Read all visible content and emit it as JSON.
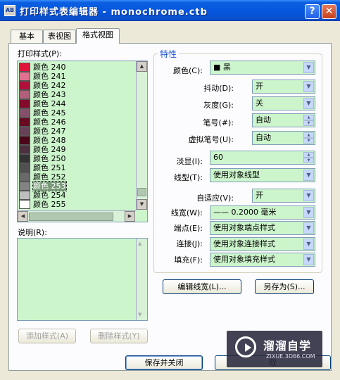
{
  "window": {
    "title": "打印样式表编辑器 - monochrome.ctb",
    "help": "?",
    "close": "✕",
    "icon": "AB"
  },
  "tabs": [
    "基本",
    "表视图",
    "格式视图"
  ],
  "left": {
    "styles_label": "打印样式(P):",
    "styles": [
      {
        "label": "颜色 240",
        "color": "#e0143c"
      },
      {
        "label": "颜色 241",
        "color": "#e07090"
      },
      {
        "label": "颜色 242",
        "color": "#b0103a"
      },
      {
        "label": "颜色 243",
        "color": "#b0607a"
      },
      {
        "label": "颜色 244",
        "color": "#840a2c"
      },
      {
        "label": "颜色 245",
        "color": "#84506a"
      },
      {
        "label": "颜色 246",
        "color": "#680822"
      },
      {
        "label": "颜色 247",
        "color": "#684058"
      },
      {
        "label": "颜色 248",
        "color": "#4c061a"
      },
      {
        "label": "颜色 249",
        "color": "#4c3040"
      },
      {
        "label": "颜色 250",
        "color": "#333333"
      },
      {
        "label": "颜色 251",
        "color": "#505050"
      },
      {
        "label": "颜色 252",
        "color": "#696969"
      },
      {
        "label": "颜色 253",
        "color": "#828282"
      },
      {
        "label": "颜色 254",
        "color": "#bebebe"
      },
      {
        "label": "颜色 255",
        "color": "#ffffff"
      }
    ],
    "selected_index": 13,
    "desc_label": "说明(R):",
    "add_btn": "添加样式(A)",
    "del_btn": "删除样式(Y)"
  },
  "props": {
    "group_title": "特性",
    "color_label": "颜色(C):",
    "color_value": "■ 黑",
    "dither_label": "抖动(D):",
    "dither_value": "开",
    "gray_label": "灰度(G):",
    "gray_value": "关",
    "pen_label": "笔号(#):",
    "pen_value": "自动",
    "vpen_label": "虚拟笔号(U):",
    "vpen_value": "自动",
    "screen_label": "淡显(I):",
    "screen_value": "60",
    "ltype_label": "线型(T):",
    "ltype_value": "使用对象线型",
    "adapt_label": "自适应(V):",
    "adapt_value": "开",
    "lw_label": "线宽(W):",
    "lw_value": "—— 0.2000 毫米",
    "end_label": "端点(E):",
    "end_value": "使用对象端点样式",
    "join_label": "连接(J):",
    "join_value": "使用对象连接样式",
    "fill_label": "填充(F):",
    "fill_value": "使用对象填充样式",
    "edit_lw_btn": "编辑线宽(L)...",
    "saveas_btn": "另存为(S)..."
  },
  "bottom": {
    "save_close": "保存并关闭",
    "cancel": "取"
  },
  "watermark": {
    "name": "溜溜自学",
    "url": "ZIXUE.3D66.COM"
  }
}
